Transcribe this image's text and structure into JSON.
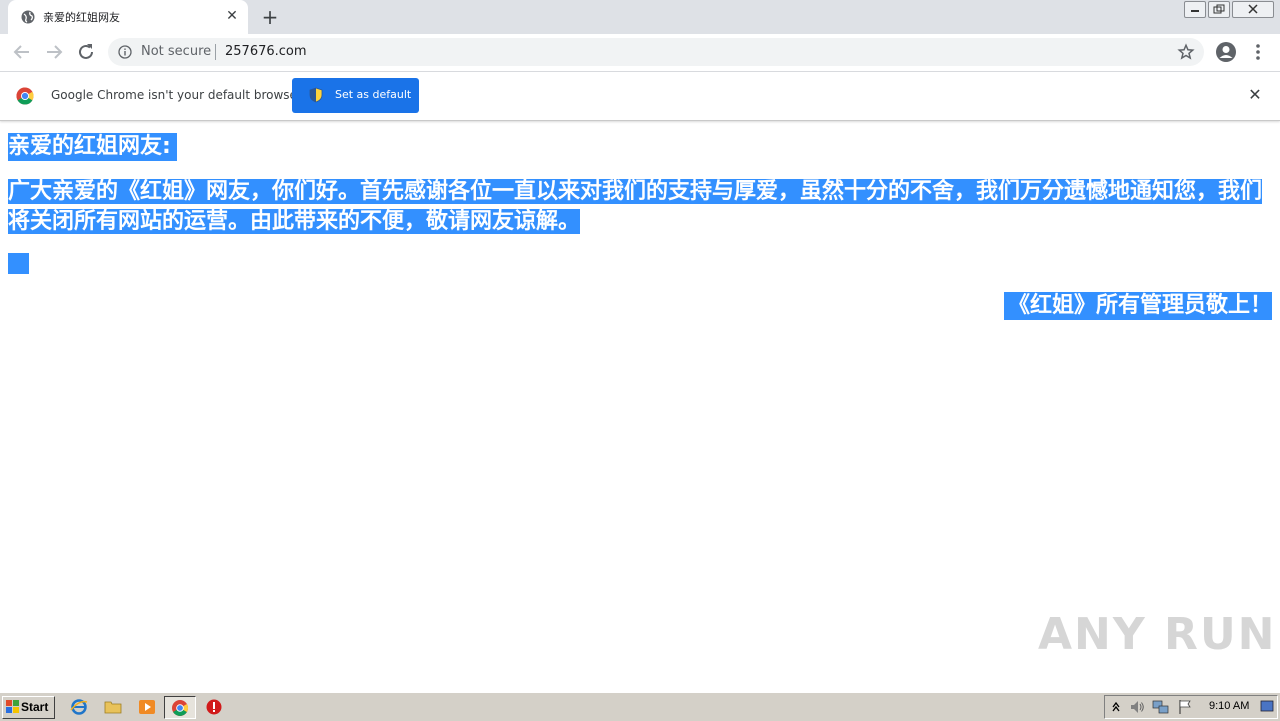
{
  "browser": {
    "tab": {
      "title": "亲爱的红姐网友",
      "close": "✕"
    },
    "new_tab": "+",
    "address": {
      "security_label": "Not secure",
      "url": "257676.com"
    }
  },
  "infobar": {
    "message": "Google Chrome isn't your default browser",
    "button_label": "Set as default",
    "close": "✕"
  },
  "page": {
    "heading": "亲爱的红姐网友:",
    "paragraph": "广大亲爱的《红姐》网友，你们好。首先感谢各位一直以来对我们的支持与厚爱，虽然十分的不舍，我们万分遗憾地通知您，我们将关闭所有网站的运营。由此带来的不便，敬请网友谅解。",
    "signature": "《红姐》所有管理员敬上！"
  },
  "watermark": "ANY RUN",
  "taskbar": {
    "start_label": "Start",
    "clock": "9:10 AM"
  },
  "colors": {
    "selection": "#3390ff",
    "accent_button": "#1a73e8",
    "tabstrip": "#dee1e6",
    "taskbar": "#d4d0c8"
  }
}
